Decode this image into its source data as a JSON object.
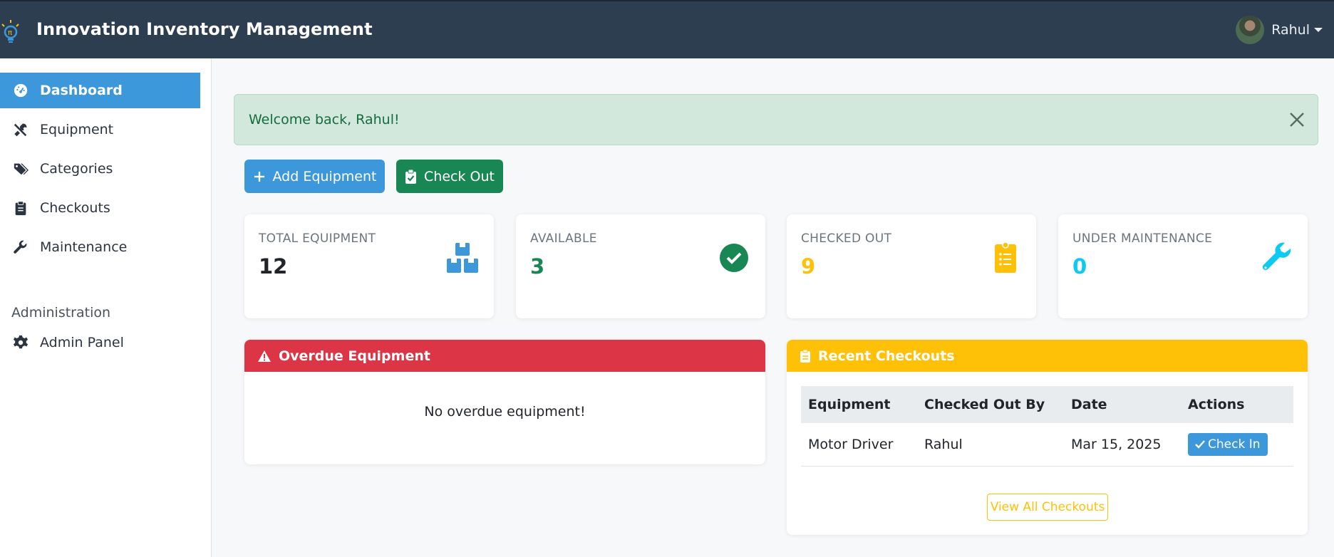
{
  "navbar": {
    "title": "Innovation Inventory Management",
    "user_name": "Rahul",
    "logo_icon": "lightbulb-icon",
    "avatar_icon": "user-avatar"
  },
  "sidebar": {
    "items": [
      {
        "label": "Dashboard",
        "icon": "dashboard-icon",
        "active": true
      },
      {
        "label": "Equipment",
        "icon": "tools-icon"
      },
      {
        "label": "Categories",
        "icon": "tags-icon"
      },
      {
        "label": "Checkouts",
        "icon": "clipboard-icon"
      },
      {
        "label": "Maintenance",
        "icon": "wrench-icon"
      }
    ],
    "admin_section": "Administration",
    "admin_item": {
      "label": "Admin Panel",
      "icon": "gear-icon"
    }
  },
  "alert": {
    "message": "Welcome back, Rahul!",
    "close_icon": "close-icon"
  },
  "actions": {
    "add_label": "Add Equipment",
    "checkout_label": "Check Out"
  },
  "stats": [
    {
      "label": "TOTAL EQUIPMENT",
      "value": "12",
      "color": "#212529",
      "icon": "boxes-icon"
    },
    {
      "label": "AVAILABLE",
      "value": "3",
      "color": "#198754",
      "icon": "check-circle-icon"
    },
    {
      "label": "CHECKED OUT",
      "value": "9",
      "color": "#ffc107",
      "icon": "clipboard-list-icon"
    },
    {
      "label": "UNDER MAINTENANCE",
      "value": "0",
      "color": "#0dcaf0",
      "icon": "wrench-icon"
    }
  ],
  "overdue": {
    "title": "Overdue Equipment",
    "empty_message": "No overdue equipment!"
  },
  "recent": {
    "title": "Recent Checkouts",
    "columns": [
      "Equipment",
      "Checked Out By",
      "Date",
      "Actions"
    ],
    "rows": [
      {
        "equipment": "Motor Driver",
        "by": "Rahul",
        "date": "Mar 15, 2025",
        "action": "Check In"
      }
    ],
    "view_all": "View All Checkouts"
  },
  "colors": {
    "navbar": "#2e3e51",
    "primary": "#3c98db",
    "success": "#198754",
    "danger": "#dc3545",
    "warning": "#ffc107",
    "info": "#0dcaf0"
  }
}
